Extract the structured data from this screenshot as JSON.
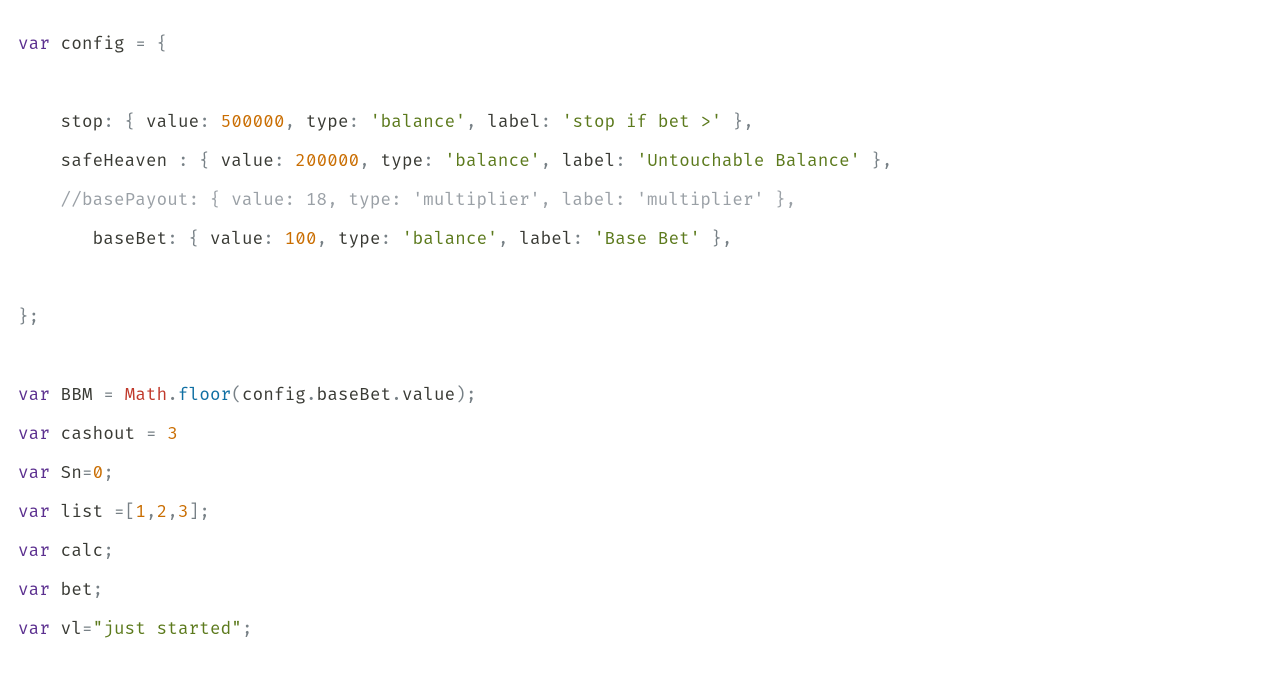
{
  "code": {
    "l1": {
      "kw": "var",
      "id": "config",
      "eq": "=",
      "brace": "{"
    },
    "l2": {
      "idA": "stop",
      "c1": ":",
      "br1": "{",
      "idV": "value",
      "c2": ":",
      "num": "500000",
      "cm1": ",",
      "idT": "type",
      "c3": ":",
      "str1": "'balance'",
      "cm2": ",",
      "idL": "label",
      "c4": ":",
      "str2": "'stop if bet >'",
      "br2": "}",
      "cm3": ","
    },
    "l3": {
      "idA": "safeHeaven",
      "c1": ":",
      "br1": "{",
      "idV": "value",
      "c2": ":",
      "num": "200000",
      "cm1": ",",
      "idT": "type",
      "c3": ":",
      "str1": "'balance'",
      "cm2": ",",
      "idL": "label",
      "c4": ":",
      "str2": "'Untouchable Balance'",
      "br2": "}",
      "cm3": ","
    },
    "l4": {
      "cmt": "//basePayout: { value: 18, type: 'multiplier', label: 'multiplier' },"
    },
    "l5": {
      "idA": "baseBet",
      "c1": ":",
      "br1": "{",
      "idV": "value",
      "c2": ":",
      "num": "100",
      "cm1": ",",
      "idT": "type",
      "c3": ":",
      "str1": "'balance'",
      "cm2": ",",
      "idL": "label",
      "c4": ":",
      "str2": "'Base Bet'",
      "br2": "}",
      "cm3": ","
    },
    "l6": {
      "brace": "}",
      "semi": ";"
    },
    "l7": {
      "kw": "var",
      "id": "BBM",
      "eq": "=",
      "obj": "Math",
      "dot": ".",
      "fn": "floor",
      "p1": "(",
      "a": "config",
      "d1": ".",
      "b": "baseBet",
      "d2": ".",
      "c": "value",
      "p2": ")",
      "semi": ";"
    },
    "l8": {
      "kw": "var",
      "id": "cashout",
      "eq": "=",
      "num": "3"
    },
    "l9": {
      "kw": "var",
      "id": "Sn",
      "eq": "=",
      "num": "0",
      "semi": ";"
    },
    "l10": {
      "kw": "var",
      "id": "list",
      "eq": "=",
      "br1": "[",
      "n1": "1",
      "c1": ",",
      "n2": "2",
      "c2": ",",
      "n3": "3",
      "br2": "]",
      "semi": ";"
    },
    "l11": {
      "kw": "var",
      "id": "calc",
      "semi": ";"
    },
    "l12": {
      "kw": "var",
      "id": "bet",
      "semi": ";"
    },
    "l13": {
      "kw": "var",
      "id": "vl",
      "eq": "=",
      "str": "\"just started\"",
      "semi": ";"
    }
  }
}
